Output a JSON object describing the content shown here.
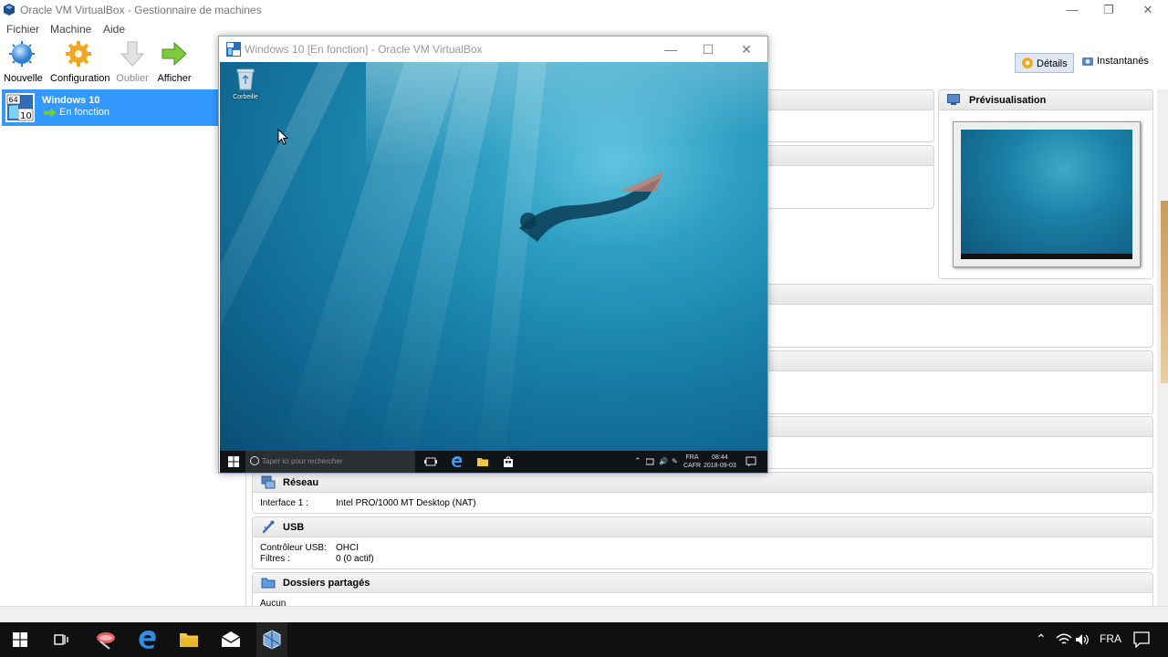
{
  "manager": {
    "title": "Oracle VM VirtualBox - Gestionnaire de machines",
    "menu": [
      "Fichier",
      "Machine",
      "Aide"
    ],
    "toolbar": {
      "new": "Nouvelle",
      "settings": "Configuration",
      "discard": "Oublier",
      "show": "Afficher"
    },
    "right_tools": {
      "details": "Détails",
      "snapshots": "Instantanés"
    },
    "vm": {
      "name": "Windows 10",
      "state": "En fonction",
      "os_badge_top": "64",
      "os_badge_bottom": "10"
    },
    "preview": {
      "title": "Prévisualisation"
    },
    "sections": {
      "network": {
        "title": "Réseau",
        "rows": [
          {
            "key": "Interface 1 :",
            "value": "Intel PRO/1000 MT Desktop (NAT)"
          }
        ]
      },
      "usb": {
        "title": "USB",
        "rows": [
          {
            "key": "Contrôleur USB:",
            "value": "OHCI"
          },
          {
            "key": "Filtres :",
            "value": "0 (0 actif)"
          }
        ]
      },
      "shared": {
        "title": "Dossiers partagés",
        "rows": [
          {
            "key": "Aucun",
            "value": ""
          }
        ]
      }
    }
  },
  "vm_window": {
    "title": "Windows 10 [En fonction] - Oracle VM VirtualBox",
    "desktop": {
      "recycle_bin": "Corbeille"
    },
    "taskbar": {
      "search_placeholder": "Taper ici pour rechercher",
      "lang_top": "FRA",
      "lang_bottom": "CAFR",
      "time": "08:44",
      "date": "2018-09-03"
    }
  },
  "host_taskbar": {
    "lang": "FRA"
  },
  "colors": {
    "selection": "#3399ff",
    "taskbar": "#101010",
    "ocean": "#1982aa"
  }
}
